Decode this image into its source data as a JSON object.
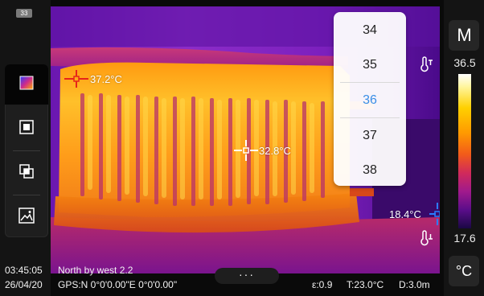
{
  "status_bar": {
    "battery_level": "33"
  },
  "left_toolbar": {
    "items": [
      {
        "icon": "color-palette-icon",
        "active": true
      },
      {
        "icon": "square-frame-icon",
        "active": false
      },
      {
        "icon": "overlay-icon",
        "active": false
      },
      {
        "icon": "gallery-icon",
        "active": false
      }
    ]
  },
  "right_toolbar": {
    "mode_icon": "manual-mode-icon",
    "mode_label": "M",
    "scale_max": "36.5",
    "scale_min": "17.6",
    "high_level_icon": "thermometer-high-icon",
    "low_level_icon": "thermometer-low-icon",
    "unit_label": "°C"
  },
  "picker": {
    "options": [
      "34",
      "35",
      "36",
      "37",
      "38"
    ],
    "selected": "36"
  },
  "markers": {
    "hot_spot": "37.2°C",
    "center_spot": "32.8°C",
    "cold_spot": "18.4°C"
  },
  "bottom_status": {
    "time": "03:45:05",
    "date": "26/04/20",
    "heading": "North by west 2.2",
    "gps": "GPS:N 0°0'0.00\"E 0°0'0.00\"",
    "emissivity": "ε:0.9",
    "ambient": "T:23.0°C",
    "distance": "D:3.0m",
    "menu_label": "···"
  },
  "colors": {
    "accent": "#3a8ee6",
    "cross_red": "#e6241a",
    "cold_blue": "#2b7cff",
    "background": "#141414"
  }
}
